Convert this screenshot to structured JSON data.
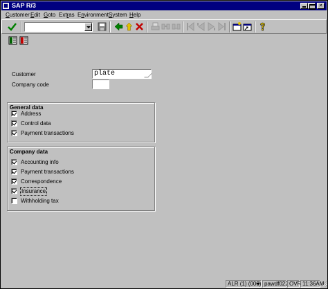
{
  "window": {
    "title": "SAP R/3"
  },
  "menu": [
    {
      "label": "Customer",
      "underline_index": 0
    },
    {
      "label": "Edit",
      "underline_index": 0
    },
    {
      "label": "Goto",
      "underline_index": 0
    },
    {
      "label": "Extras",
      "underline_index": 3
    },
    {
      "label": "Environment",
      "underline_index": 1
    },
    {
      "label": "System",
      "underline_index": 0
    },
    {
      "label": "Help",
      "underline_index": 0
    }
  ],
  "toolbar": {
    "command_field": {
      "value": "",
      "placeholder": ""
    },
    "icons": [
      "enter-check-icon",
      "save-icon",
      "back-icon",
      "exit-icon",
      "cancel-icon",
      "print-icon",
      "find-icon",
      "find-next-icon",
      "first-page-icon",
      "previous-page-icon",
      "next-page-icon",
      "last-page-icon",
      "create-session-icon",
      "generate-shortcut-icon",
      "help-icon"
    ]
  },
  "app_toolbar": {
    "icons": [
      "list-icon",
      "other-object-icon"
    ]
  },
  "form": {
    "customer_label": "Customer",
    "customer_value": "plate",
    "company_code_label": "Company code",
    "company_code_value": ""
  },
  "general_data": {
    "title": "General data",
    "items": [
      {
        "label": "Address",
        "checked": true
      },
      {
        "label": "Control data",
        "checked": true
      },
      {
        "label": "Payment transactions",
        "checked": true
      }
    ]
  },
  "company_data": {
    "title": "Company data",
    "items": [
      {
        "label": "Accounting info",
        "checked": true
      },
      {
        "label": "Payment transactions",
        "checked": true
      },
      {
        "label": "Correspondence",
        "checked": true
      },
      {
        "label": "Insurance",
        "checked": true,
        "focused": true
      },
      {
        "label": "Withholding tax",
        "checked": false
      }
    ]
  },
  "statusbar": {
    "system": "ALR (1) (000)",
    "server": "pawdf022",
    "mode": "OVR",
    "time": "11:36AM"
  },
  "colors": {
    "title_bar": "#000080",
    "background": "#c0c0c0",
    "enter_green": "#008000",
    "cancel_red": "#c00000",
    "help_yellow": "#e0c000"
  }
}
